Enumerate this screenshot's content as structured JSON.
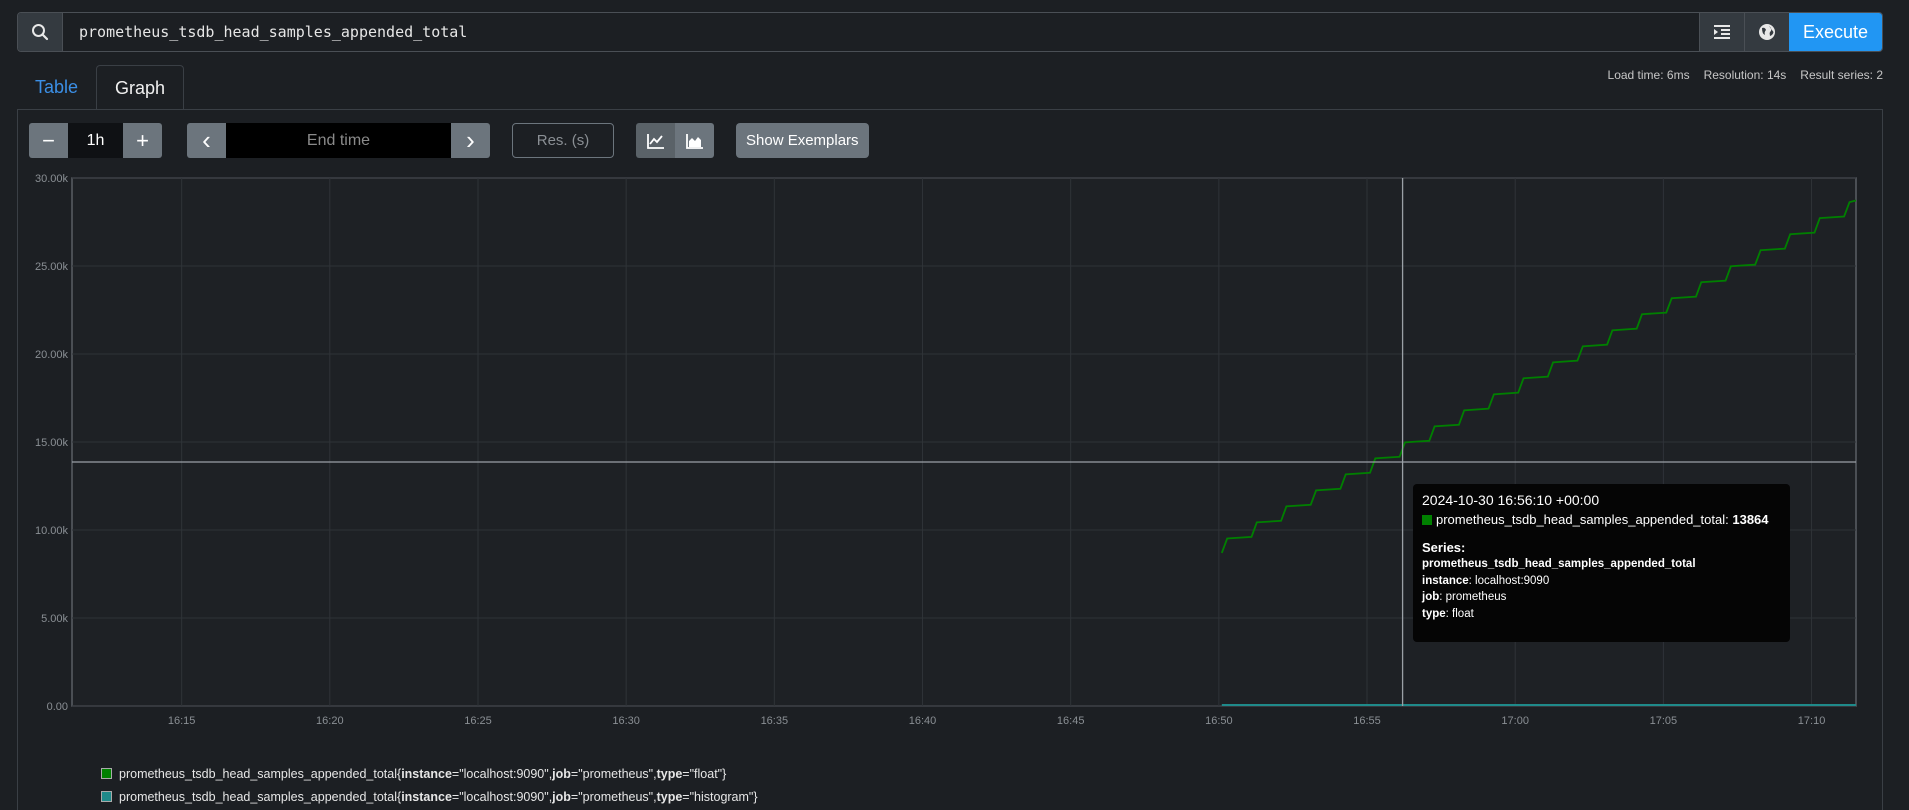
{
  "query": {
    "value": "prometheus_tsdb_head_samples_appended_total"
  },
  "toolbar": {
    "execute_label": "Execute",
    "icons": [
      "search-icon",
      "format-icon",
      "globe-icon"
    ]
  },
  "tabs": [
    {
      "label": "Table"
    },
    {
      "label": "Graph"
    }
  ],
  "stats": {
    "load_time": "Load time: 6ms",
    "resolution": "Resolution: 14s",
    "result_series": "Result series: 2"
  },
  "controls": {
    "minus": "−",
    "range": "1h",
    "plus": "+",
    "prev": "‹",
    "end_time_placeholder": "End time",
    "next": "›",
    "res_placeholder": "Res. (s)",
    "show_exemplars": "Show Exemplars"
  },
  "chart_data": {
    "type": "line",
    "x_ticks": [
      "16:15",
      "16:20",
      "16:25",
      "16:30",
      "16:35",
      "16:40",
      "16:45",
      "16:50",
      "16:55",
      "17:00",
      "17:05",
      "17:10"
    ],
    "y_ticks": [
      "0.00",
      "5.00k",
      "10.00k",
      "15.00k",
      "20.00k",
      "25.00k",
      "30.00k"
    ],
    "ylim": [
      0,
      30000
    ],
    "xlim_minutes_from_1615": [
      -3.7,
      56.5
    ],
    "grid": true,
    "series": [
      {
        "name": "prometheus_tsdb_head_samples_appended_total{instance=\"localhost:9090\", job=\"prometheus\", type=\"float\"}",
        "color": "#008000",
        "stair_start_minute": 35.1,
        "stair_start_value": 8700,
        "stair_step_value": 910,
        "stair_step_minutes": 1.0,
        "end_value": 27600
      },
      {
        "name": "prometheus_tsdb_head_samples_appended_total{instance=\"localhost:9090\", job=\"prometheus\", type=\"histogram\"}",
        "color": "#1f8a8a",
        "start_minute": 35.1,
        "value": 0
      }
    ],
    "crosshair": {
      "minute": 41.2,
      "value": 13864
    }
  },
  "tooltip": {
    "timestamp": "2024-10-30 16:56:10 +00:00",
    "metric": "prometheus_tsdb_head_samples_appended_total:",
    "value": "13864",
    "series_heading": "Series:",
    "series_name": "prometheus_tsdb_head_samples_appended_total",
    "labels": [
      {
        "key": "instance",
        "val": ": localhost:9090"
      },
      {
        "key": "job",
        "val": ": prometheus"
      },
      {
        "key": "type",
        "val": ": float"
      }
    ]
  },
  "legend": [
    {
      "metric": "prometheus_tsdb_head_samples_appended_total",
      "color": "#008000",
      "parts": [
        "{",
        "instance",
        "=\"localhost:9090\", ",
        "job",
        "=\"prometheus\", ",
        "type",
        "=\"float\"}"
      ]
    },
    {
      "metric": "prometheus_tsdb_head_samples_appended_total",
      "color": "#1f8a8a",
      "parts": [
        "{",
        "instance",
        "=\"localhost:9090\", ",
        "job",
        "=\"prometheus\", ",
        "type",
        "=\"histogram\"}"
      ]
    }
  ]
}
